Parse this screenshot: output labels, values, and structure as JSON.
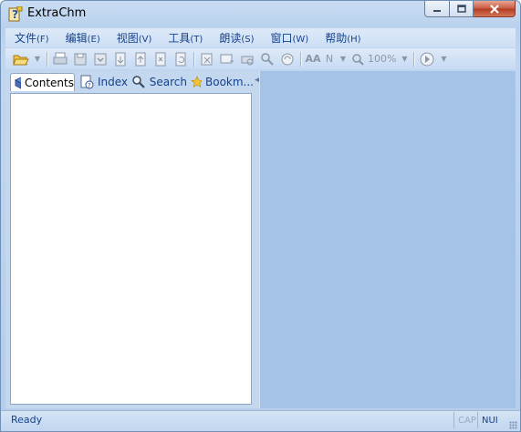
{
  "window": {
    "title": "ExtraChm",
    "controls": {
      "minimize_icon": "minimize-icon",
      "maximize_icon": "maximize-icon",
      "close_icon": "close-icon"
    }
  },
  "menu": [
    {
      "label": "文件",
      "hotkey": "(F)"
    },
    {
      "label": "编辑",
      "hotkey": "(E)"
    },
    {
      "label": "视图",
      "hotkey": "(V)"
    },
    {
      "label": "工具",
      "hotkey": "(T)"
    },
    {
      "label": "朗读",
      "hotkey": "(S)"
    },
    {
      "label": "窗口",
      "hotkey": "(W)"
    },
    {
      "label": "帮助",
      "hotkey": "(H)"
    }
  ],
  "toolbar": {
    "font_size_label": "AA",
    "font_name_label": "N",
    "zoom_value": "100%"
  },
  "tabs": [
    {
      "label": "Contents",
      "icon": "contents-book-icon",
      "active": true
    },
    {
      "label": "Index",
      "icon": "index-page-icon",
      "active": false
    },
    {
      "label": "Search",
      "icon": "search-icon",
      "active": false
    },
    {
      "label": "Bookm...",
      "icon": "bookmark-star-icon",
      "active": false
    }
  ],
  "status": {
    "text": "Ready",
    "caps": "CAP",
    "num": "NUI"
  },
  "colors": {
    "title_text": "#000000",
    "menu_text": "#15428b",
    "content_area": "#a5c2e8",
    "tree_panel": "#ffffff",
    "close_button": "#c75a3f"
  }
}
